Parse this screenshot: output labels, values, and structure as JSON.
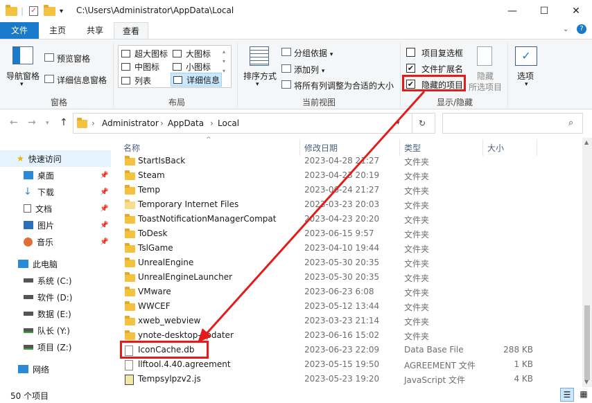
{
  "window": {
    "path": "C:\\Users\\Administrator\\AppData\\Local",
    "minimize": "—",
    "maximize": "☐",
    "close": "✕"
  },
  "tabs": [
    "文件",
    "主页",
    "共享",
    "查看"
  ],
  "ribbon": {
    "panes": {
      "nav_pane": "导航窗格",
      "preview": "预览窗格",
      "details_pane": "详细信息窗格",
      "group": "窗格"
    },
    "layout": {
      "items": [
        "超大图标",
        "大图标",
        "中图标",
        "小图标",
        "列表",
        "详细信息"
      ],
      "group": "布局"
    },
    "current_view": {
      "sort": "排序方式",
      "group_by": "分组依据",
      "add_column": "添加列",
      "fit_columns": "将所有列调整为合适的大小",
      "group": "当前视图"
    },
    "show_hide": {
      "item_checkboxes": "项目复选框",
      "file_extensions": "文件扩展名",
      "hidden_items": "隐藏的项目",
      "hide_selected_1": "隐藏",
      "hide_selected_2": "所选项目",
      "options": "选项",
      "group": "显示/隐藏"
    },
    "checks": {
      "item_checkboxes": "",
      "file_extensions": "✔",
      "hidden_items": "✔"
    }
  },
  "breadcrumb": [
    "Administrator",
    "AppData",
    "Local"
  ],
  "nav": {
    "quick_access": "快速访问",
    "items": [
      "桌面",
      "下载",
      "文档",
      "图片",
      "音乐"
    ],
    "this_pc": "此电脑",
    "drives": [
      "系统 (C:)",
      "软件 (D:)",
      "数据 (E:)",
      "队长 (Y:)",
      "项目 (Z:)"
    ],
    "network": "网络"
  },
  "columns": {
    "name": "名称",
    "date": "修改日期",
    "type": "类型",
    "size": "大小"
  },
  "files": [
    {
      "name": "StartIsBack",
      "date": "2023-04-28 21:27",
      "type": "文件夹",
      "size": "",
      "kind": "folder"
    },
    {
      "name": "Steam",
      "date": "2023-04-23 20:19",
      "type": "文件夹",
      "size": "",
      "kind": "folder"
    },
    {
      "name": "Temp",
      "date": "2023-06-24 21:27",
      "type": "文件夹",
      "size": "",
      "kind": "folder"
    },
    {
      "name": "Temporary Internet Files",
      "date": "2023-03-23 20:03",
      "type": "文件夹",
      "size": "",
      "kind": "pale"
    },
    {
      "name": "ToastNotificationManagerCompat",
      "date": "2023-04-23 20:20",
      "type": "文件夹",
      "size": "",
      "kind": "folder"
    },
    {
      "name": "ToDesk",
      "date": "2023-06-15 9:57",
      "type": "文件夹",
      "size": "",
      "kind": "folder"
    },
    {
      "name": "TslGame",
      "date": "2023-04-10 19:44",
      "type": "文件夹",
      "size": "",
      "kind": "folder"
    },
    {
      "name": "UnrealEngine",
      "date": "2023-05-30 20:35",
      "type": "文件夹",
      "size": "",
      "kind": "folder"
    },
    {
      "name": "UnrealEngineLauncher",
      "date": "2023-05-30 20:35",
      "type": "文件夹",
      "size": "",
      "kind": "folder"
    },
    {
      "name": "VMware",
      "date": "2023-06-23 6:08",
      "type": "文件夹",
      "size": "",
      "kind": "folder"
    },
    {
      "name": "WWCEF",
      "date": "2023-05-12 13:44",
      "type": "文件夹",
      "size": "",
      "kind": "folder"
    },
    {
      "name": "xweb_webview",
      "date": "2023-03-23 21:14",
      "type": "文件夹",
      "size": "",
      "kind": "folder"
    },
    {
      "name": "ynote-desktop-updater",
      "date": "2023-06-16 15:02",
      "type": "文件夹",
      "size": "",
      "kind": "folder"
    },
    {
      "name": "IconCache.db",
      "date": "2023-06-23 22:09",
      "type": "Data Base File",
      "size": "288 KB",
      "kind": "doc"
    },
    {
      "name": "llftool.4.40.agreement",
      "date": "2023-05-15 19:50",
      "type": "AGREEMENT 文件",
      "size": "1 KB",
      "kind": "doc"
    },
    {
      "name": "Tempsylpzv2.js",
      "date": "2023-05-23 19:20",
      "type": "JavaScript 文件",
      "size": "4 KB",
      "kind": "js"
    }
  ],
  "status": {
    "count": "50 个项目"
  },
  "colors": {
    "accent": "#1979ca",
    "highlight": "#e31b1b"
  }
}
